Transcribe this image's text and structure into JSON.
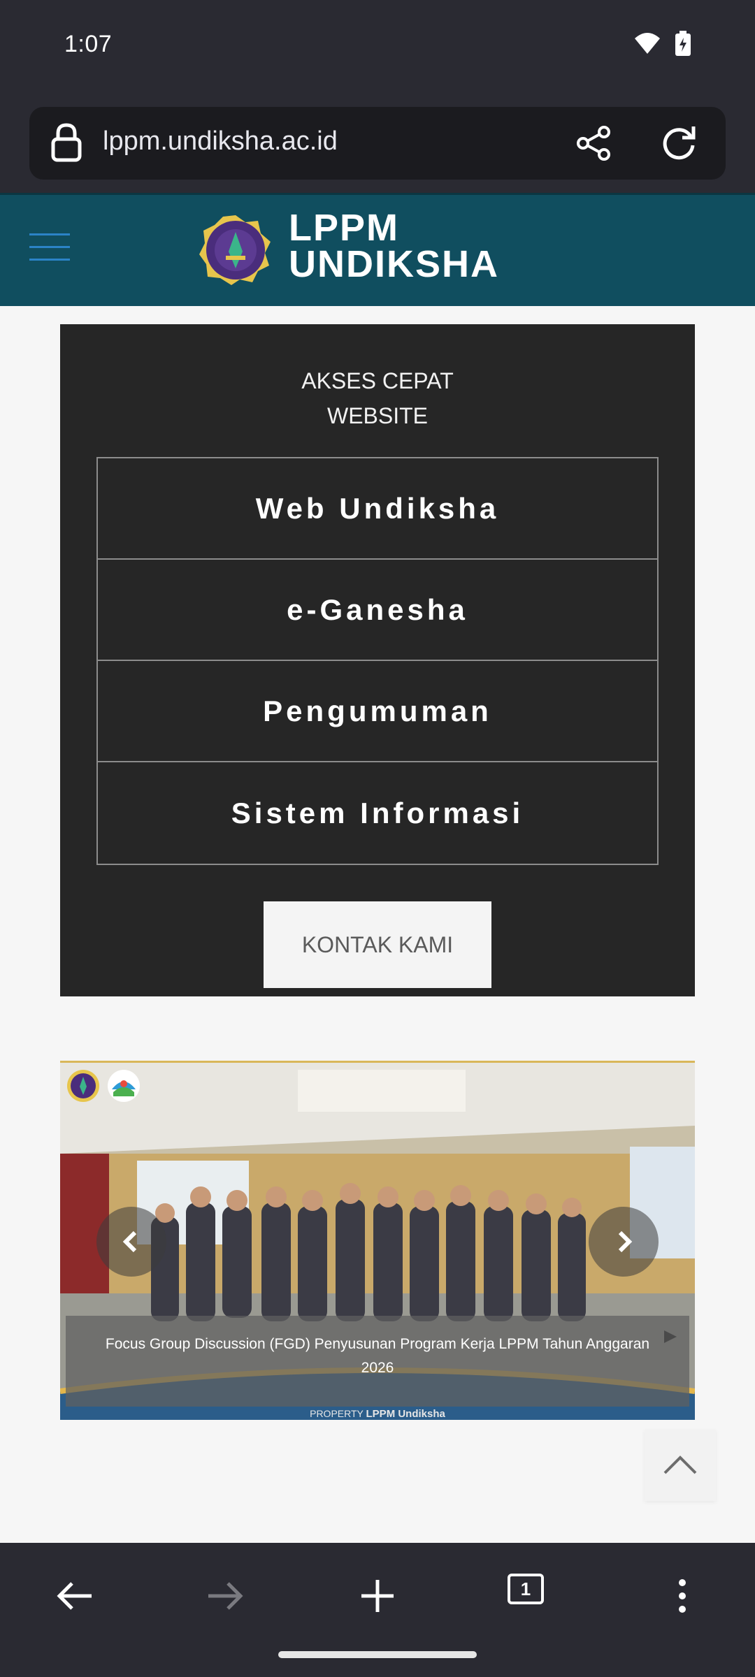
{
  "status_bar": {
    "time": "1:07",
    "icons": [
      "wifi-icon",
      "battery-charging-icon"
    ]
  },
  "browser": {
    "url": "lppm.undiksha.ac.id",
    "icons": [
      "lock-icon",
      "share-icon",
      "reload-icon"
    ],
    "toolbar": {
      "tab_count": "1",
      "icons": [
        "back-arrow-icon",
        "forward-arrow-icon",
        "new-tab-icon",
        "tab-switcher-icon",
        "more-vert-icon"
      ]
    }
  },
  "site": {
    "brand_line1": "LPPM",
    "brand_line2": "UNDIKSHA",
    "quick_access": {
      "title_line1": "AKSES CEPAT",
      "title_line2": "WEBSITE",
      "links": [
        "Web Undiksha",
        "e-Ganesha",
        "Pengumuman",
        "Sistem Informasi"
      ],
      "contact_label": "KONTAK KAMI"
    },
    "slider": {
      "caption": "Focus Group Discussion (FGD) Penyusunan Program Kerja LPPM Tahun Anggaran 2026",
      "property_prefix": "PROPERTY",
      "property_owner": "LPPM Undiksha"
    }
  },
  "colors": {
    "chrome_bg": "#2a2a32",
    "header_bg": "#104e5f",
    "panel_bg": "#262626",
    "accent_menu": "#2b83c7"
  }
}
